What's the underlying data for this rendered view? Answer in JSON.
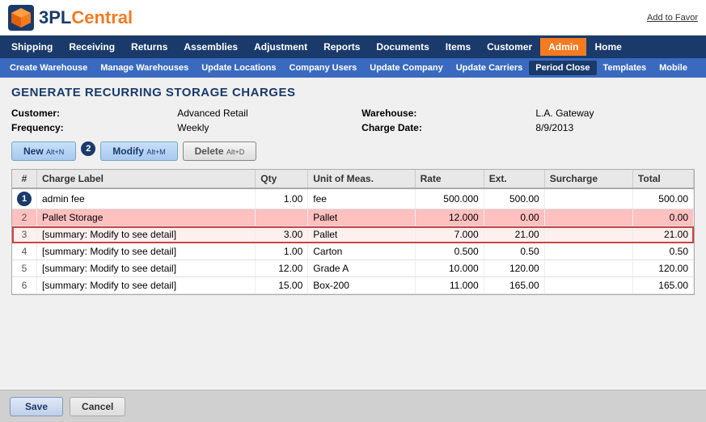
{
  "app": {
    "name": "3PL Central",
    "logo_text_3pl": "3PL",
    "logo_text_central": "Central",
    "add_to_favor": "Add to Favor"
  },
  "main_nav": {
    "items": [
      {
        "label": "Shipping",
        "active": false
      },
      {
        "label": "Receiving",
        "active": false
      },
      {
        "label": "Returns",
        "active": false
      },
      {
        "label": "Assemblies",
        "active": false
      },
      {
        "label": "Adjustment",
        "active": false
      },
      {
        "label": "Reports",
        "active": false
      },
      {
        "label": "Documents",
        "active": false
      },
      {
        "label": "Items",
        "active": false
      },
      {
        "label": "Customer",
        "active": false
      },
      {
        "label": "Admin",
        "active": true
      },
      {
        "label": "Home",
        "active": false
      }
    ]
  },
  "sub_nav": {
    "items": [
      {
        "label": "Create Warehouse",
        "active": false
      },
      {
        "label": "Manage Warehouses",
        "active": false
      },
      {
        "label": "Update Locations",
        "active": false
      },
      {
        "label": "Company Users",
        "active": false
      },
      {
        "label": "Update Company",
        "active": false
      },
      {
        "label": "Update Carriers",
        "active": false
      },
      {
        "label": "Period Close",
        "active": true
      },
      {
        "label": "Templates",
        "active": false
      },
      {
        "label": "Mobile",
        "active": false
      }
    ]
  },
  "page": {
    "title": "Generate Recurring Storage Charges",
    "customer_label": "Customer:",
    "customer_value": "Advanced Retail",
    "warehouse_label": "Warehouse:",
    "warehouse_value": "L.A. Gateway",
    "frequency_label": "Frequency:",
    "frequency_value": "Weekly",
    "charge_date_label": "Charge Date:",
    "charge_date_value": "8/9/2013"
  },
  "toolbar": {
    "new_label": "New",
    "new_shortcut": "Alt+N",
    "modify_label": "Modify",
    "modify_shortcut": "Alt+M",
    "delete_label": "Delete",
    "delete_shortcut": "Alt+D"
  },
  "table": {
    "headers": [
      "#",
      "Charge Label",
      "Qty",
      "Unit of Meas.",
      "Rate",
      "Ext.",
      "Surcharge",
      "Total"
    ],
    "rows": [
      {
        "num": "1",
        "label": "admin fee",
        "qty": "1.00",
        "unit": "fee",
        "rate": "500.000",
        "ext": "500.00",
        "surcharge": "",
        "total": "500.00",
        "style": "normal"
      },
      {
        "num": "2",
        "label": "Pallet Storage",
        "qty": "",
        "unit": "Pallet",
        "rate": "12.000",
        "ext": "0.00",
        "surcharge": "",
        "total": "0.00",
        "style": "pink"
      },
      {
        "num": "3",
        "label": "[summary: Modify to see detail]",
        "qty": "3.00",
        "unit": "Pallet",
        "rate": "7.000",
        "ext": "21.00",
        "surcharge": "",
        "total": "21.00",
        "style": "outline"
      },
      {
        "num": "4",
        "label": "[summary: Modify to see detail]",
        "qty": "1.00",
        "unit": "Carton",
        "rate": "0.500",
        "ext": "0.50",
        "surcharge": "",
        "total": "0.50",
        "style": "normal"
      },
      {
        "num": "5",
        "label": "[summary: Modify to see detail]",
        "qty": "12.00",
        "unit": "Grade A",
        "rate": "10.000",
        "ext": "120.00",
        "surcharge": "",
        "total": "120.00",
        "style": "normal"
      },
      {
        "num": "6",
        "label": "[summary: Modify to see detail]",
        "qty": "15.00",
        "unit": "Box-200",
        "rate": "11.000",
        "ext": "165.00",
        "surcharge": "",
        "total": "165.00",
        "style": "normal"
      }
    ]
  },
  "bottom": {
    "save_label": "Save",
    "cancel_label": "Cancel"
  }
}
